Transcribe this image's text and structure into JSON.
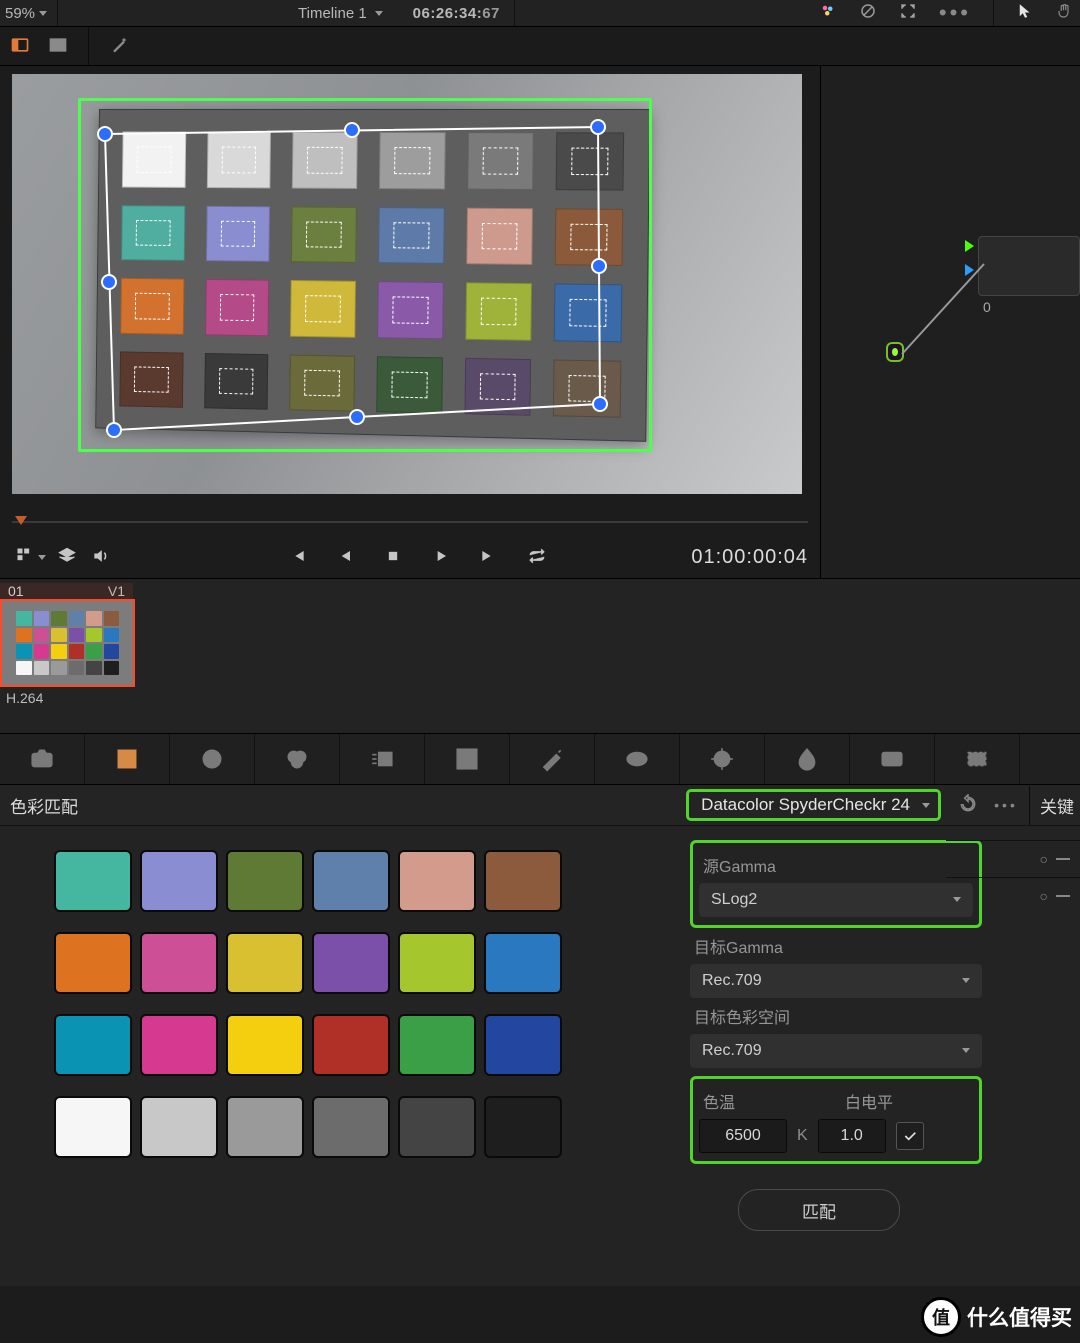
{
  "topbar": {
    "zoom": "59%",
    "timeline": "Timeline 1",
    "timecode": "06:26:34:",
    "frames": "67"
  },
  "viewer": {
    "chips": [
      [
        "#f2f2f2",
        "#d9d9d9",
        "#bfbfbf",
        "#9d9d9d",
        "#7a7a7a",
        "#4a4a4a"
      ],
      [
        "#4fae9f",
        "#8a8dcf",
        "#6b7f3e",
        "#5e7aa8",
        "#cf9a8e",
        "#8b5a3a"
      ],
      [
        "#d2722e",
        "#b44a88",
        "#d0b93a",
        "#8a5aa8",
        "#9fb33a",
        "#3a6aa8"
      ],
      [
        "#5a3a2e",
        "#3a3a3a",
        "#6a6a3a",
        "#3a5a3a",
        "#5a4a6a",
        "#6a5a4a"
      ]
    ]
  },
  "playbar": {
    "timecode": "01:00:00:04"
  },
  "clip": {
    "index": "01",
    "track": "V1",
    "codec": "H.264"
  },
  "node": {
    "label": "0"
  },
  "panel": {
    "title": "色彩匹配",
    "chart_select": "Datacolor SpyderCheckr 24",
    "keyframe_tab": "关键",
    "swatches": [
      [
        "#45b6a0",
        "#8a8dd1",
        "#5f7a34",
        "#5e80aa",
        "#d39b8b",
        "#8c5a3c"
      ],
      [
        "#dd7220",
        "#cd4f95",
        "#d8c030",
        "#7a50a8",
        "#a6c62e",
        "#2a79c0"
      ],
      [
        "#0a93b2",
        "#d63a90",
        "#f4cf10",
        "#b03028",
        "#3a9f46",
        "#2346a0"
      ],
      [
        "#f6f6f6",
        "#c8c8c8",
        "#9a9a9a",
        "#6c6c6c",
        "#444444",
        "#1e1e1e"
      ]
    ],
    "labels": {
      "src_gamma": "源Gamma",
      "dst_gamma": "目标Gamma",
      "dst_cs": "目标色彩空间",
      "temp": "色温",
      "white": "白电平",
      "temp_unit": "K",
      "match": "匹配"
    },
    "values": {
      "src_gamma": "SLog2",
      "dst_gamma": "Rec.709",
      "dst_cs": "Rec.709",
      "temp": "6500",
      "white": "1.0",
      "use_temp": true
    }
  },
  "watermark": "什么值得买"
}
